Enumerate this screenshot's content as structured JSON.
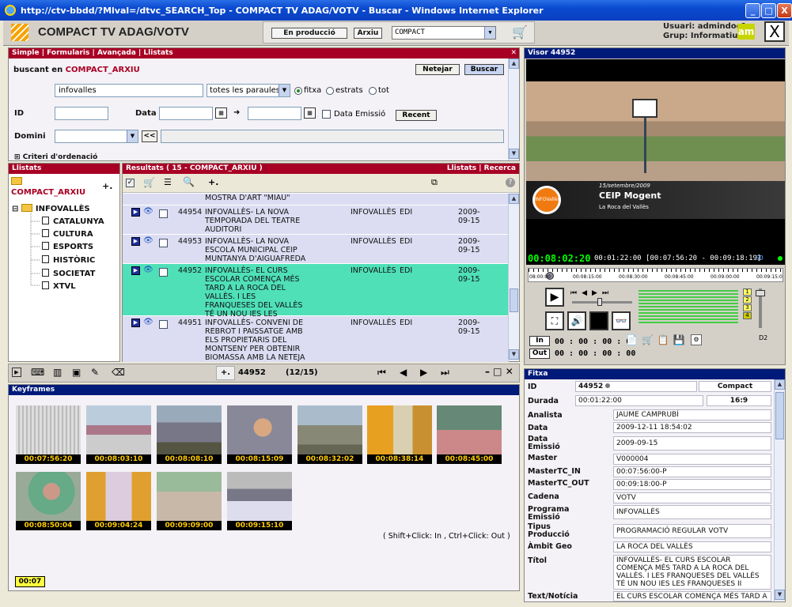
{
  "window": {
    "title": "http://ctv-bbdd/?Mlval=/dtvc_SEARCH_Top - COMPACT TV ADAG/VOTV - Buscar - Windows Internet Explorer",
    "min": "_",
    "max": "□",
    "close": "X"
  },
  "header": {
    "app_title": "COMPACT TV ADAG/VOTV",
    "btn_production": "En producció",
    "btn_archive": "Arxiu",
    "db_select": "COMPACT",
    "user_label": "Usuari: admindoc1",
    "group_label": "Grup: Informatius",
    "am_logo": "am"
  },
  "search": {
    "tabs": [
      "Simple",
      "Formularis",
      "Avançada",
      "Llistats"
    ],
    "searching_prefix": "buscant en",
    "searching_db": "COMPACT_ARXIU",
    "btn_clear": "Netejar",
    "btn_search": "Buscar",
    "query": "infovalles",
    "words_select": "totes les paraules",
    "radio_fitxa": "fitxa",
    "radio_estrats": "estrats",
    "radio_tot": "tot",
    "label_id": "ID",
    "label_data": "Data",
    "label_emissio": "Data Emissió",
    "btn_recent": "Recent",
    "label_domini": "Domini",
    "btn_back": "<<",
    "criteria": "Criteri d'ordenació"
  },
  "llistats": {
    "title": "Llistats",
    "root": "COMPACT_ARXIU",
    "folder": "INFOVALLÈS",
    "items": [
      "CATALUNYA",
      "CULTURA",
      "ESPORTS",
      "HISTÒRIC",
      "SOCIETAT",
      "XTVL"
    ]
  },
  "results": {
    "title": "Resultats ( 15 - COMPACT_ARXIU )",
    "links": [
      "Llistats",
      "Recerca"
    ],
    "partial_row": "MOSTRA D'ART \"MIAU\"",
    "rows": [
      {
        "id": "44954",
        "title": "INFOVALLÈS- LA NOVA TEMPORADA DEL TEATRE AUDITORI",
        "program": "INFOVALLÈS",
        "edit": "EDI",
        "date": "2009-09-15"
      },
      {
        "id": "44953",
        "title": "INFOVALLÈS- LA NOVA ESCOLA MUNICIPAL CEIP MUNTANYA D'AIGUAFREDA",
        "program": "INFOVALLÈS",
        "edit": "EDI",
        "date": "2009-09-15"
      },
      {
        "id": "44952",
        "title": "INFOVALLÈS- EL CURS ESCOLAR COMENÇA MÉS TARD A LA ROCA DEL VALLÈS. I LES FRANQUESES DEL VALLÈS TÉ UN NOU IES LES FRANQUESES II",
        "program": "INFOVALLÈS",
        "edit": "EDI",
        "date": "2009-09-15"
      },
      {
        "id": "44951",
        "title": "INFOVALLÈS- CONVENI DE REBROT I PAISSATGE AMB ELS PROPIETARIS DEL MONTSENY PER OBTENIR BIOMASSA AMB LA NETEJA DELS BOSCOS",
        "program": "INFOVALLÈS",
        "edit": "EDI",
        "date": "2009-09-15"
      }
    ],
    "current_id": "44952",
    "pager": "(12/15)"
  },
  "keyframes": {
    "title": "Keyframes",
    "codes": [
      "00:07:56:20",
      "00:08:03:10",
      "00:08:08:10",
      "00:08:15:09",
      "00:08:32:02",
      "00:08:38:14",
      "00:08:45:00",
      "00:08:50:04",
      "00:09:04:24",
      "00:09:09:00",
      "00:09:15:10"
    ],
    "hint": "( Shift+Click: In , Ctrl+Click: Out )",
    "duration": "00:07"
  },
  "visor": {
    "title": "Visor 44952",
    "overlay_date": "15/setembre/2009",
    "overlay_school": "CEIP Mogent",
    "overlay_place": "La Roca del Vallès",
    "overlay_logo": "INFOVallès",
    "tc_current": "00:08:02:20",
    "tc_info": "00:01:22:00 [00:07:56:20 - 00:09:18:19]",
    "timeline": [
      "08:00:00",
      "00:08:15:00",
      "00:08:30:00",
      "00:08:45:00",
      "00:09:00:00",
      "00:09:15:0"
    ],
    "btn_in": "In",
    "btn_out": "Out",
    "in_tc": "00 : 00 : 00 : 00",
    "out_tc": "00 : 00 : 00 : 00",
    "tracks": [
      "1",
      "2",
      "3",
      "4"
    ],
    "d2": "D2",
    "sd": "SD"
  },
  "fitxa": {
    "title": "Fitxa",
    "id_label": "ID",
    "id_value": "44952",
    "compact": "Compact",
    "durada_label": "Durada",
    "durada_value": "00:01:22:00",
    "aspect": "16:9",
    "fields": [
      {
        "label": "Analista",
        "value": "JAUME CAMPRUBÍ"
      },
      {
        "label": "Data",
        "value": "2009-12-11 18:54:02"
      },
      {
        "label": "Data Emissió",
        "value": "2009-09-15"
      },
      {
        "label": "Master",
        "value": "V000004"
      },
      {
        "label": "MasterTC_IN",
        "value": "00:07:56:00-P"
      },
      {
        "label": "MasterTC_OUT",
        "value": "00:09:18:00-P"
      },
      {
        "label": "Cadena",
        "value": "VOTV"
      },
      {
        "label": "Programa Emissió",
        "value": "INFOVALLÈS"
      },
      {
        "label": "Tipus Producció",
        "value": "PROGRAMACIÓ REGULAR VOTV"
      },
      {
        "label": "Àmbit Geo",
        "value": "LA ROCA DEL VALLÈS"
      },
      {
        "label": "Títol",
        "value": "INFOVALLÈS- EL CURS ESCOLAR COMENÇA MÉS TARD A LA ROCA DEL VALLÈS. I LES FRANQUESES DEL VALLÈS TÉ UN NOU IES LES FRANQUESES II"
      },
      {
        "label": "Text/Notícia",
        "value": "EL CURS ESCOLAR COMENÇA MÉS TARD A"
      }
    ]
  }
}
